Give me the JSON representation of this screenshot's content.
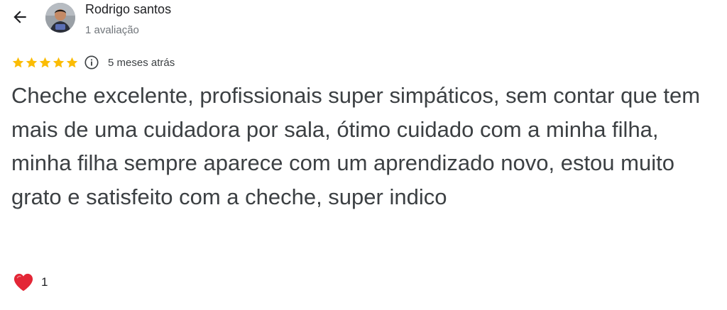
{
  "reviewer": {
    "name": "Rodrigo santos",
    "review_count": "1 avaliação"
  },
  "rating": {
    "stars": 5,
    "max_stars": 5,
    "star_color": "#fbbc04",
    "date": "5 meses atrás"
  },
  "review": {
    "text": "Cheche excelente, profissionais super simpáticos, sem contar que tem mais de uma cuidadora por sala, ótimo cuidado com a minha filha, minha filha sempre aparece com um aprendizado novo, estou muito grato e satisfeito com a cheche, super indico"
  },
  "reactions": {
    "heart_count": "1",
    "heart_color": "#e32636"
  },
  "icons": {
    "back": "arrow-left-icon",
    "info": "info-circle-icon",
    "star": "star-icon",
    "reaction": "heart-icon"
  }
}
